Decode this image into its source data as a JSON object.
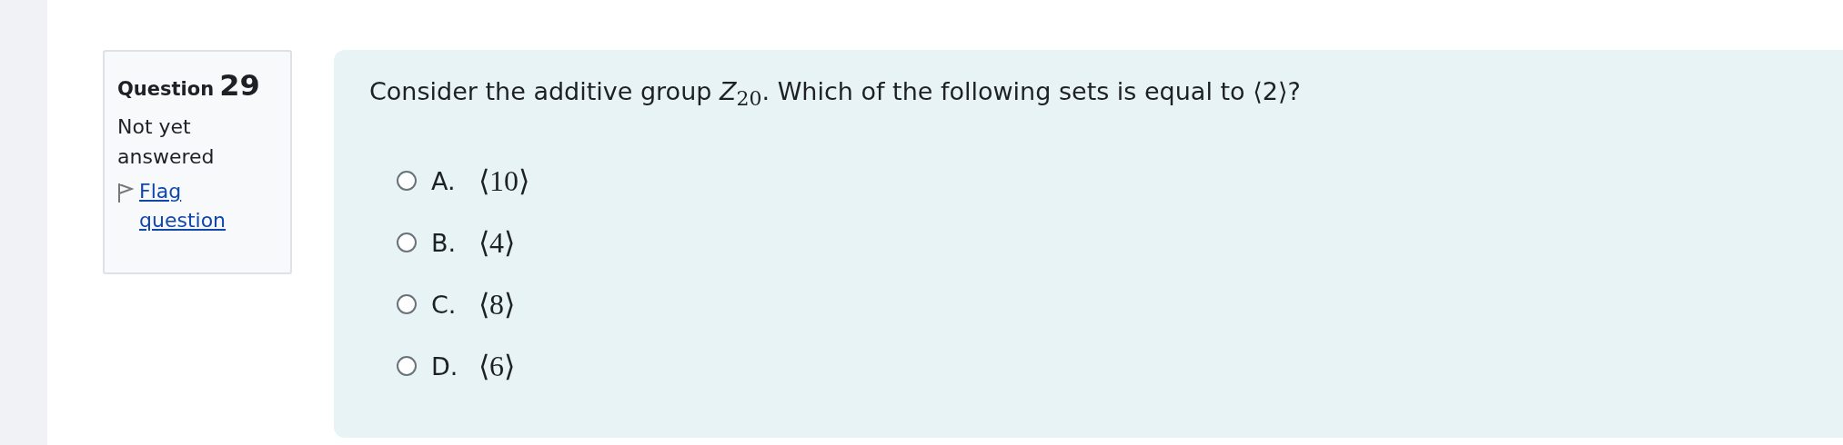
{
  "question_info": {
    "label": "Question",
    "number": "29",
    "status": "Not yet answered",
    "flag_link": "Flag question"
  },
  "question": {
    "text": "Consider the additive group *Z*$_{20}$. Which of the following sets is equal to ⟨2⟩?",
    "options": [
      {
        "letter": "A.",
        "value": "⟨10⟩",
        "selected": false
      },
      {
        "letter": "B.",
        "value": "⟨4⟩",
        "selected": false
      },
      {
        "letter": "C.",
        "value": "⟨8⟩",
        "selected": false
      },
      {
        "letter": "D.",
        "value": "⟨6⟩",
        "selected": false
      }
    ]
  }
}
